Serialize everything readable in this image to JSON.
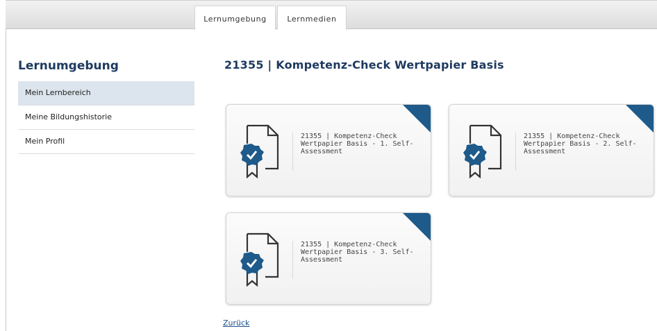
{
  "tabs": [
    {
      "label": "Lernumgebung"
    },
    {
      "label": "Lernmedien"
    }
  ],
  "sidebar": {
    "title": "Lernumgebung",
    "items": [
      {
        "label": "Mein Lernbereich",
        "active": true
      },
      {
        "label": "Meine Bildungshistorie",
        "active": false
      },
      {
        "label": "Mein Profil",
        "active": false
      }
    ]
  },
  "main": {
    "title": "21355 | Kompetenz-Check Wertpapier Basis",
    "cards": [
      {
        "title": "21355 | Kompetenz-Check Wertpapier Basis - 1. Self-Assessment",
        "icon": "certificate-icon"
      },
      {
        "title": "21355 | Kompetenz-Check Wertpapier Basis - 2. Self-Assessment",
        "icon": "certificate-icon"
      },
      {
        "title": "21355 | Kompetenz-Check Wertpapier Basis - 3. Self-Assessment",
        "icon": "certificate-icon"
      }
    ],
    "back_link": "Zurück"
  },
  "colors": {
    "accent": "#1e5a8a",
    "title": "#1e3a5f",
    "active_item_bg": "#dce5ed"
  }
}
